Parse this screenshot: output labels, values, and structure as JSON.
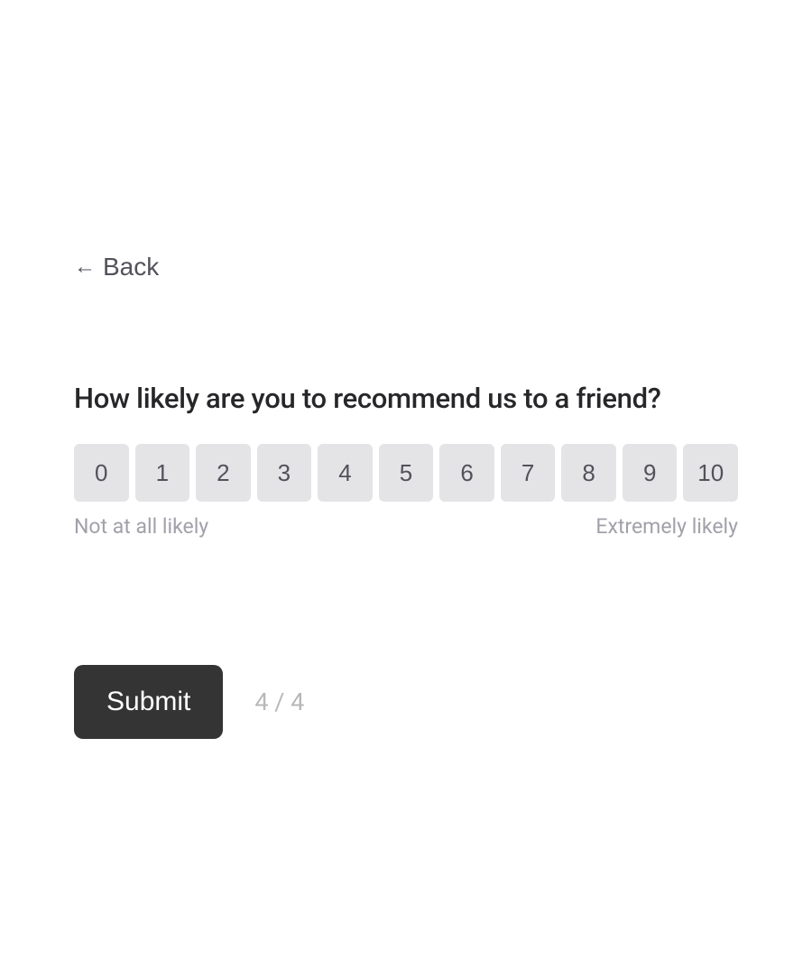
{
  "back": {
    "label": "Back",
    "arrow": "←"
  },
  "question": "How likely are you to recommend us to a friend?",
  "scale": {
    "options": [
      "0",
      "1",
      "2",
      "3",
      "4",
      "5",
      "6",
      "7",
      "8",
      "9",
      "10"
    ],
    "labelLow": "Not at all likely",
    "labelHigh": "Extremely likely"
  },
  "submit": {
    "label": "Submit"
  },
  "progress": "4 / 4"
}
